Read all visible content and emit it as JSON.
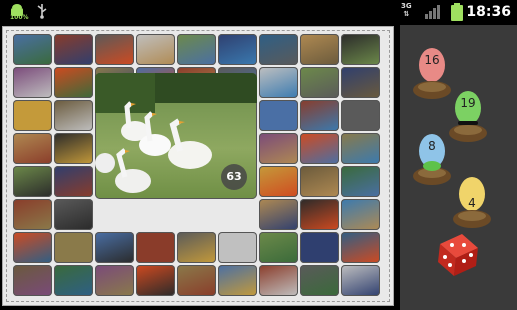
{
  "status_bar": {
    "battery_text": "100%",
    "network_label": "3G",
    "time": "18:36"
  },
  "board": {
    "big_tile_number": "63"
  },
  "players": [
    {
      "score": "16",
      "color": "#e88a86"
    },
    {
      "score": "19",
      "color": "#7cd163"
    },
    {
      "score": "8",
      "color": "#8fc4e8"
    },
    {
      "score": "4",
      "color": "#f0d46a"
    }
  ],
  "dice": {
    "label": "dice"
  }
}
